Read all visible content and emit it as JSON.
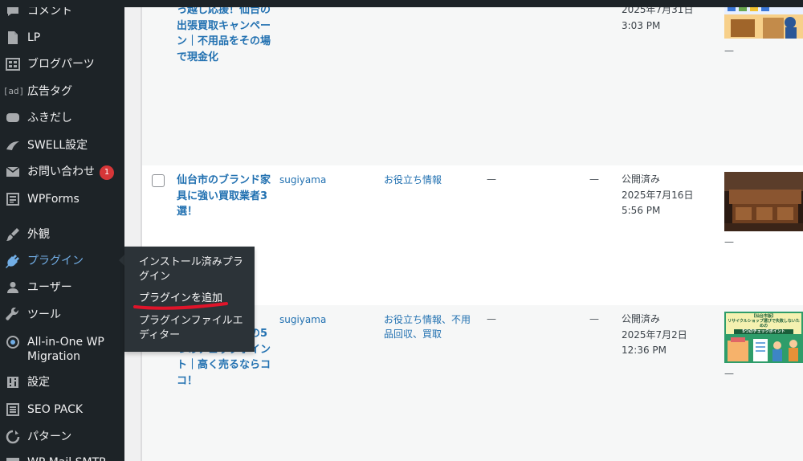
{
  "sidebar": {
    "items": [
      {
        "id": "comments",
        "label": "コメント",
        "icon": "comment-icon"
      },
      {
        "id": "lp",
        "label": "LP",
        "icon": "page-icon"
      },
      {
        "id": "blog-parts",
        "label": "ブログパーツ",
        "icon": "grid-icon"
      },
      {
        "id": "ad-tag",
        "label": "広告タグ",
        "icon": "ad-icon"
      },
      {
        "id": "fukidashi",
        "label": "ふきだし",
        "icon": "speech-bubble-icon"
      },
      {
        "id": "swell",
        "label": "SWELL設定",
        "icon": "swell-wave-icon"
      },
      {
        "id": "contact",
        "label": "お問い合わせ",
        "icon": "mail-icon",
        "badge": "1"
      },
      {
        "id": "wpforms",
        "label": "WPForms",
        "icon": "form-icon"
      },
      {
        "id": "appearance",
        "label": "外観",
        "icon": "brush-icon"
      },
      {
        "id": "plugins",
        "label": "プラグイン",
        "icon": "plugin-icon"
      },
      {
        "id": "users",
        "label": "ユーザー",
        "icon": "user-icon"
      },
      {
        "id": "tools",
        "label": "ツール",
        "icon": "wrench-icon"
      },
      {
        "id": "aio",
        "label": "All-in-One WP Migration",
        "icon": "migration-icon"
      },
      {
        "id": "settings",
        "label": "設定",
        "icon": "settings-icon"
      },
      {
        "id": "seopack",
        "label": "SEO PACK",
        "icon": "list-icon"
      },
      {
        "id": "pattern",
        "label": "パターン",
        "icon": "pattern-icon"
      },
      {
        "id": "wpmail",
        "label": "WP Mail SMTP",
        "icon": "mail-smtp-icon"
      }
    ],
    "active": "plugins",
    "accent": "#72aee6",
    "background": "#1d2327"
  },
  "flyout": {
    "items": [
      {
        "label": "インストール済みプラグイン"
      },
      {
        "label": "プラグインを追加",
        "annotated": true
      },
      {
        "label": "プラグインファイルエディター"
      }
    ],
    "annotation_color": "#e0142a"
  },
  "posts": [
    {
      "title": "っ越し応援！仙台の出張買取キャンペーン｜不用品をその場で現金化",
      "author": "",
      "categories": "",
      "tags": "",
      "comments": "",
      "status": "",
      "date": "2025年7月31日",
      "time": "3:03 PM",
      "thumb_note": "—"
    },
    {
      "title": "仙台市のブランド家具に強い買取業者3選！",
      "author": "sugiyama",
      "categories": "お役立ち情報",
      "tags": "—",
      "comments": "—",
      "status": "公開済み",
      "date": "2025年7月16日",
      "time": "5:56 PM",
      "thumb_note": "—"
    },
    {
      "title": "プ失しないための5つのチェックポイント｜高く売るならココ！",
      "author": "sugiyama",
      "categories": "お役立ち情報、不用品回収、買取",
      "tags": "—",
      "comments": "—",
      "status": "公開済み",
      "date": "2025年7月2日",
      "time": "12:36 PM",
      "thumb_note": "—",
      "thumb_text": [
        "【仙台市版】",
        "リサイクルショップ選びで失敗しないための",
        "5つのチェックポイント"
      ]
    }
  ]
}
